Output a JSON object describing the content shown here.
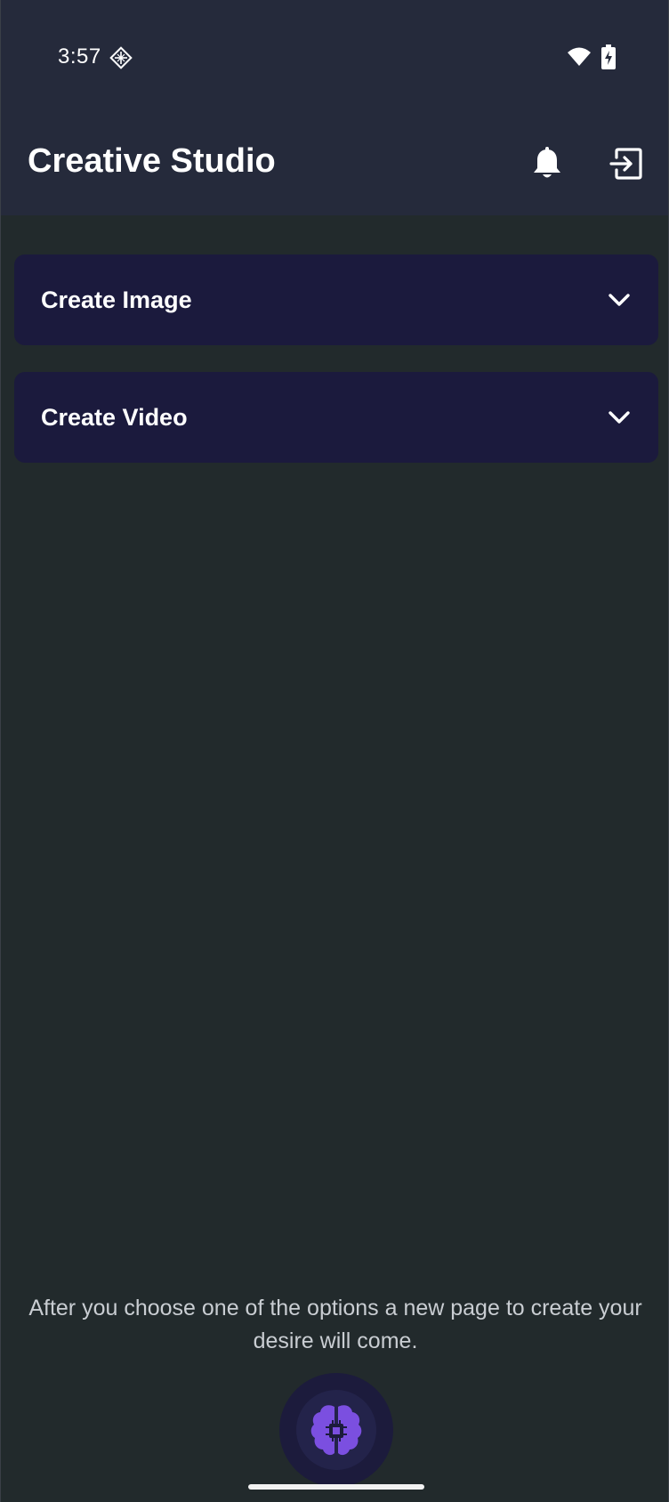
{
  "status_bar": {
    "time": "3:57",
    "app_icon": "diamond-grid-icon",
    "wifi_icon": "wifi-icon",
    "battery_icon": "battery-charging-icon"
  },
  "header": {
    "title": "Creative Studio",
    "notification_icon": "bell-icon",
    "logout_icon": "logout-icon"
  },
  "accordions": [
    {
      "label": "Create Image",
      "icon": "chevron-down-icon"
    },
    {
      "label": "Create Video",
      "icon": "chevron-down-icon"
    }
  ],
  "hint": {
    "text": "After you choose one of the options a new page to create your desire will come."
  },
  "fab": {
    "icon": "ai-brain-icon"
  },
  "colors": {
    "background": "#222a2c",
    "header_background": "#252a3b",
    "accordion_background": "#1b1a3d",
    "accent": "#7b4fe0",
    "text_primary": "#ffffff",
    "text_secondary": "#c9cdd2"
  }
}
